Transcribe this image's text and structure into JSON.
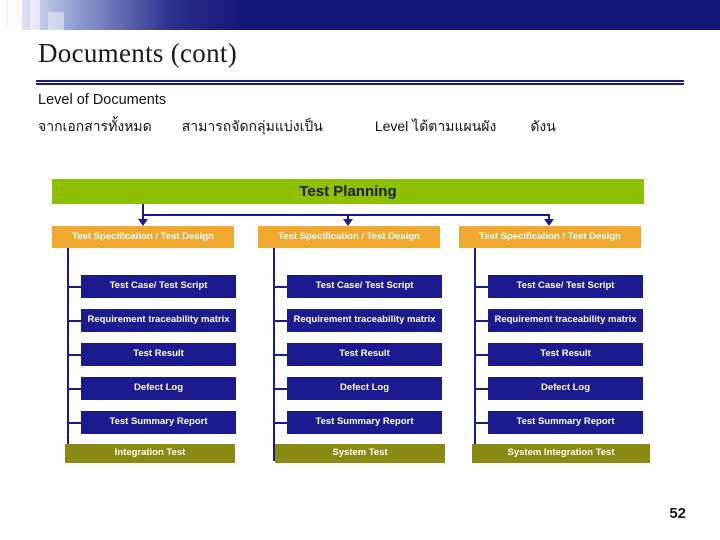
{
  "slide": {
    "title": "Documents (cont)",
    "subheading": "Level of Documents",
    "thai_line": {
      "part1": "จากเอกสารทั้งหมด",
      "part2": "สามารถจัดกลุ่มแบ่งเป็น",
      "part3": "Level ได้ตามแผนผัง",
      "part4": "ดังน"
    },
    "page_number": "52"
  },
  "colors": {
    "band": "#16177a",
    "top_node": "#8cc000",
    "spec_node": "#f0a830",
    "item_node": "#1b1b8f",
    "final_node": "#8a8a12",
    "connector": "#1b1b8f",
    "rule": "#1a1a8c"
  },
  "chart_data": {
    "type": "diagram",
    "title": "Test Planning document hierarchy",
    "root": "Test Planning",
    "columns": [
      {
        "spec": "Test Specification / Test Design",
        "items": [
          "Test Case/ Test Script",
          "Requirement traceability matrix",
          "Test Result",
          "Defect Log",
          "Test Summary Report"
        ],
        "final": "Integration Test"
      },
      {
        "spec": "Test Specification / Test Design",
        "items": [
          "Test Case/ Test Script",
          "Requirement traceability matrix",
          "Test Result",
          "Defect Log",
          "Test Summary Report"
        ],
        "final": "System Test"
      },
      {
        "spec": "Test Specification / Test Design",
        "items": [
          "Test Case/ Test Script",
          "Requirement traceability matrix",
          "Test Result",
          "Defect Log",
          "Test Summary Report"
        ],
        "final": "System Integration Test"
      }
    ]
  }
}
